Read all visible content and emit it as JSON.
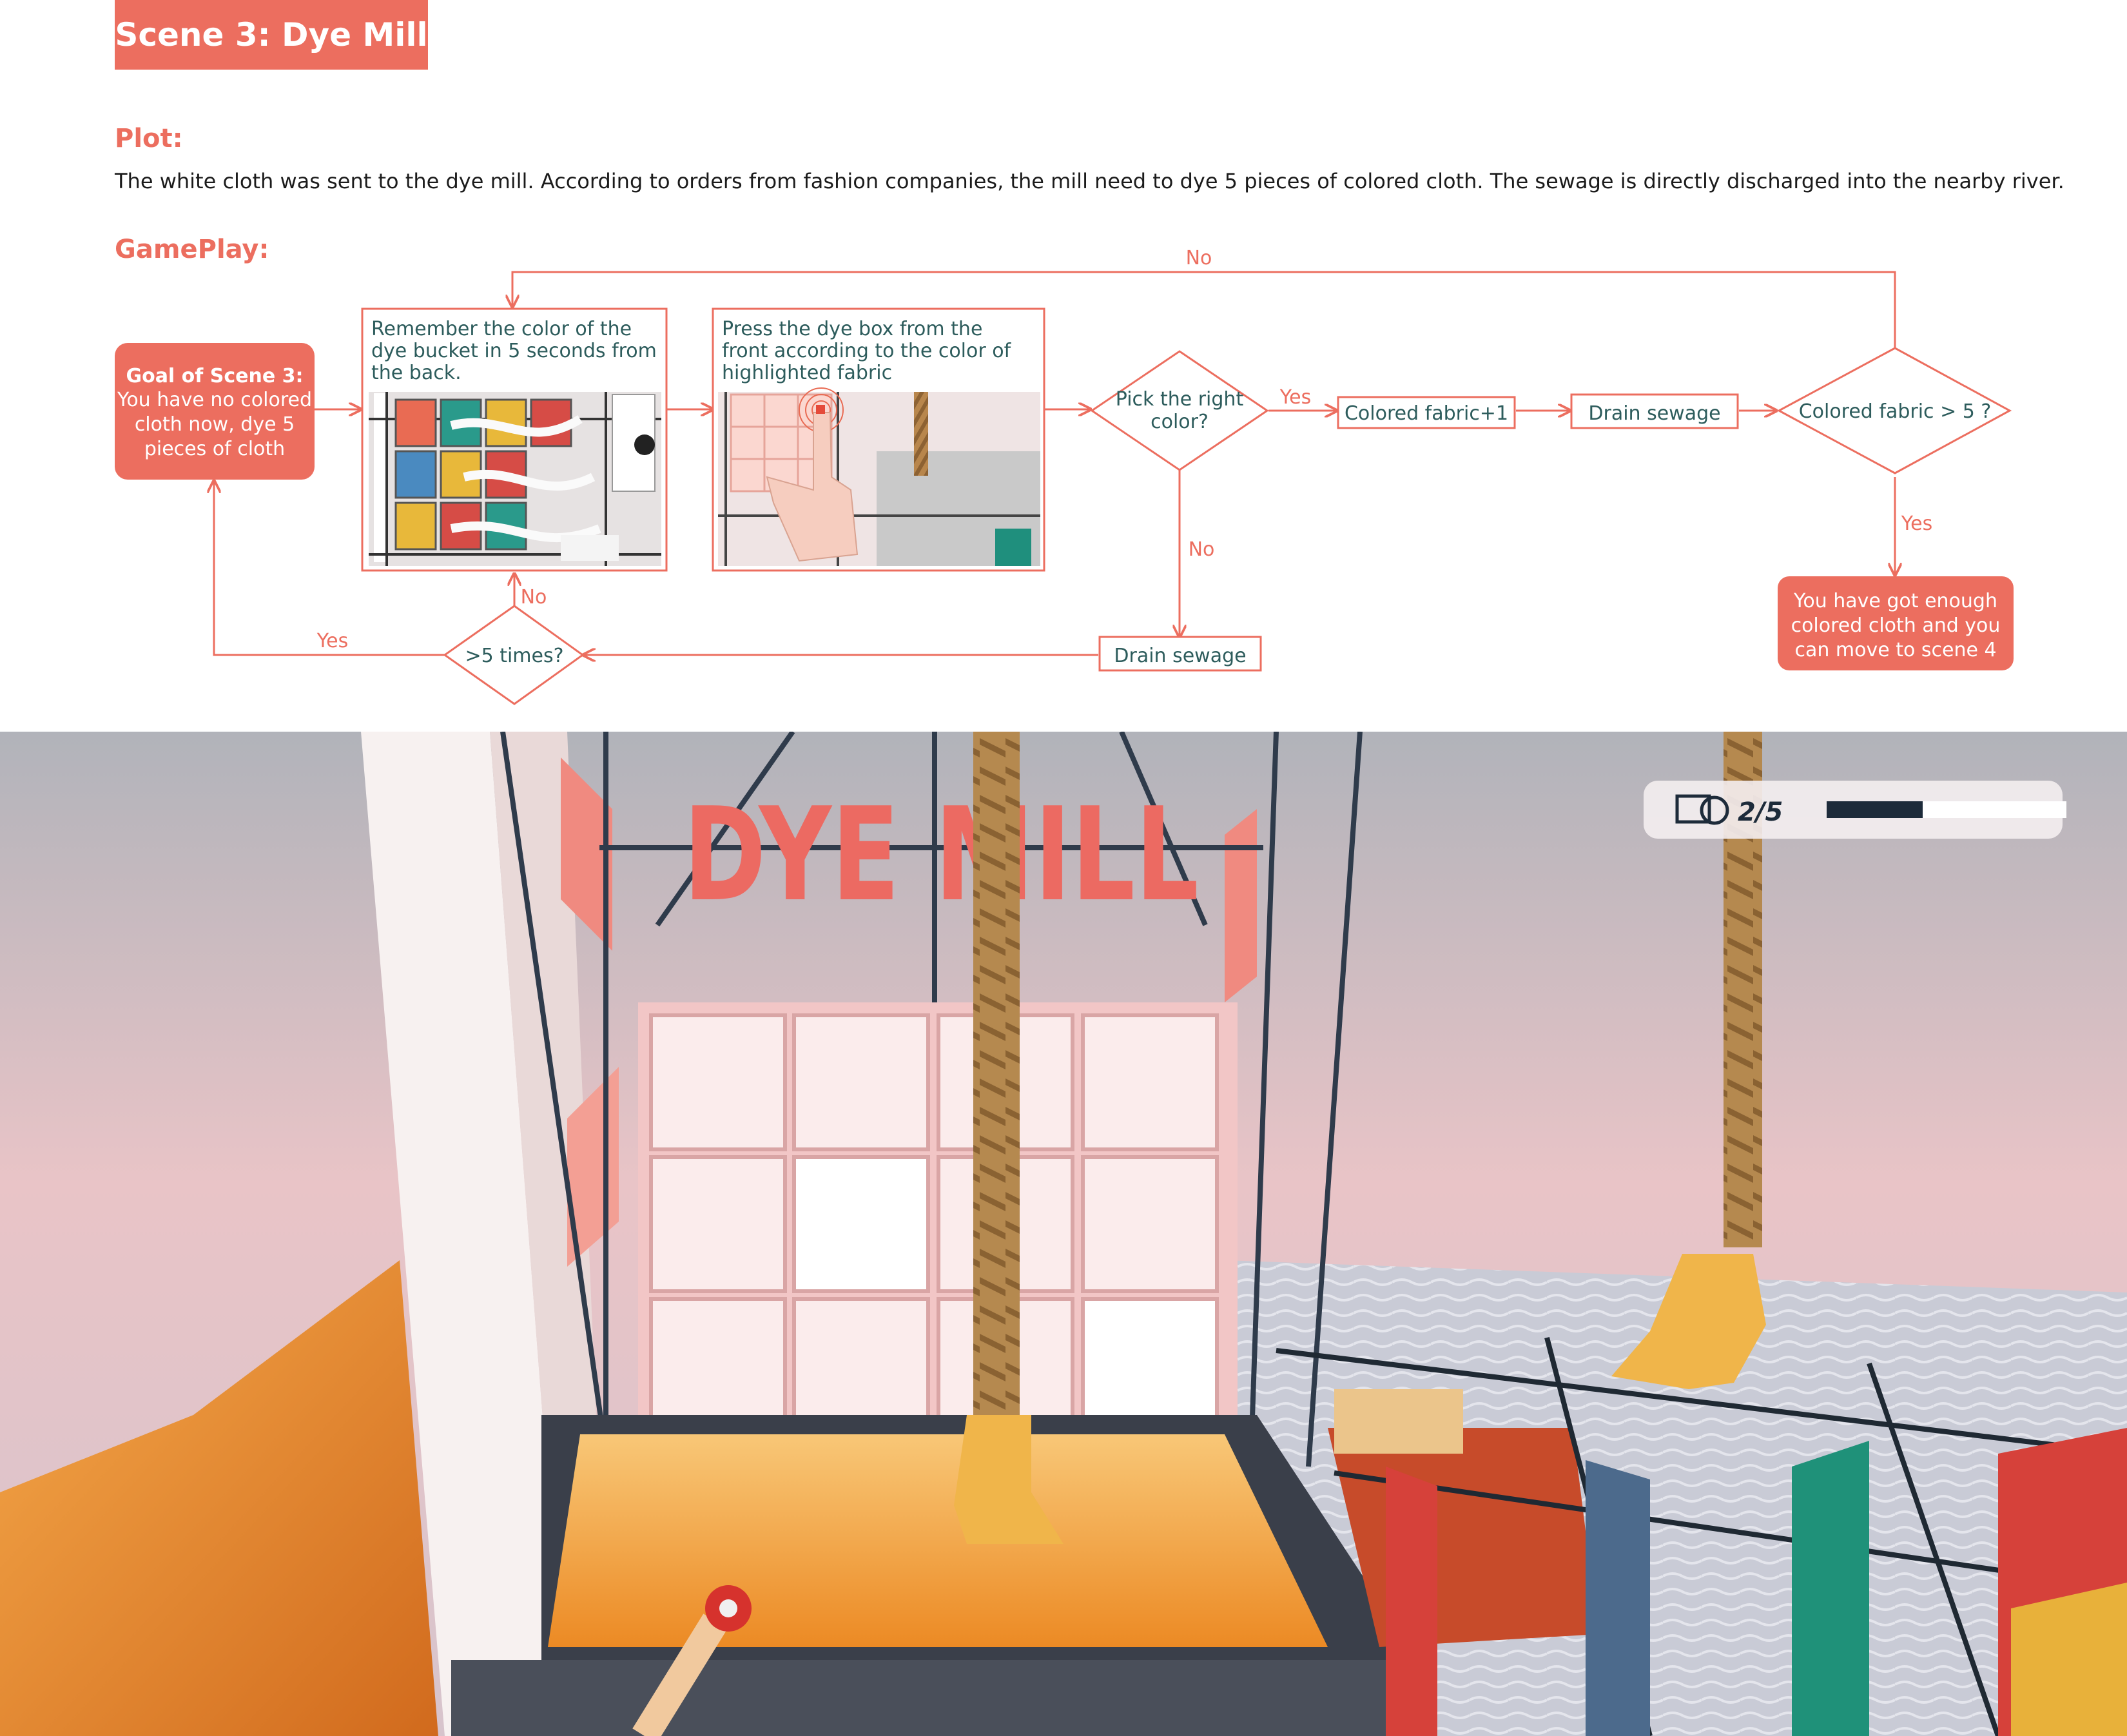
{
  "header": {
    "scene_title": "Scene 3: Dye Mill"
  },
  "plot": {
    "heading": "Plot:",
    "text": "The white cloth was sent to the dye mill. According to orders from fashion companies, the mill need to dye 5 pieces of colored cloth. The sewage is directly discharged into the nearby river."
  },
  "gameplay": {
    "heading": "GamePlay:",
    "goal": {
      "title": "Goal of  Scene 3:",
      "lines": [
        "You have no colored",
        "cloth now, dye 5",
        "pieces of cloth"
      ]
    },
    "step_remember": [
      "Remember the color of the",
      "dye bucket in 5 seconds from",
      "the back."
    ],
    "step_press": [
      "Press the dye box from the",
      "front according to the color of",
      "highlighted fabric"
    ],
    "decision_pick": [
      "Pick the right",
      "color?"
    ],
    "colored_fabric_plus": "Colored fabric+1",
    "drain_sewage_top": "Drain sewage",
    "decision_colored": "Colored fabric > 5 ?",
    "end_box": [
      "You have got enough",
      "colored cloth and you",
      "can move to scene 4"
    ],
    "drain_sewage_bottom": "Drain sewage",
    "decision_times": ">5 times?",
    "labels": {
      "no_top": "No",
      "yes_pick": "Yes",
      "no_pick": "No",
      "yes_colored": "Yes",
      "no_times": "No",
      "yes_times": "Yes"
    }
  },
  "game": {
    "sign": "DYE MILL",
    "hud": {
      "icon": "fabric-roll-icon",
      "counter": "2/5",
      "progress": 0.4
    }
  },
  "colors": {
    "accent": "#ec6e5f",
    "teal_text": "#2d5c5c",
    "hud_bar": "#1d2b3a"
  }
}
